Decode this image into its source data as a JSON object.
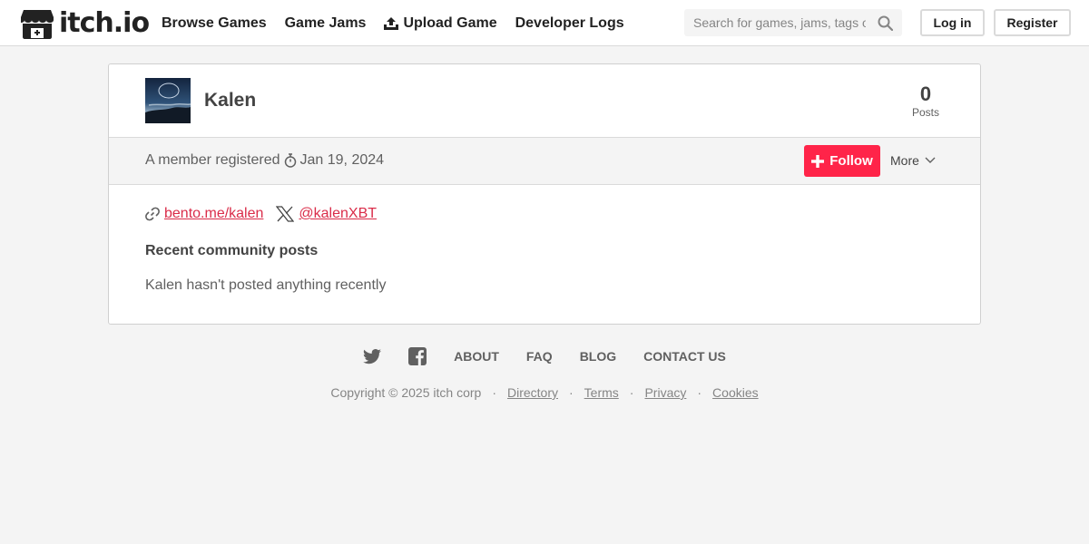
{
  "header": {
    "logo_text": "itch.io",
    "nav": [
      {
        "label": "Browse Games"
      },
      {
        "label": "Game Jams"
      },
      {
        "label": "Upload Game"
      },
      {
        "label": "Developer Logs"
      }
    ],
    "search_placeholder": "Search for games, jams, tags or creators",
    "login_label": "Log in",
    "register_label": "Register"
  },
  "profile": {
    "username": "Kalen",
    "posts_count": "0",
    "posts_label": "Posts",
    "member_text": "A member registered",
    "registered_date": "Jan 19, 2024",
    "follow_label": "Follow",
    "more_label": "More",
    "links": [
      {
        "text": "bento.me/kalen",
        "icon": "link-icon"
      },
      {
        "text": "@kalenXBT",
        "icon": "x-icon"
      }
    ],
    "recent_posts_title": "Recent community posts",
    "no_posts_text": "Kalen hasn't posted anything recently"
  },
  "footer": {
    "links": [
      "About",
      "FAQ",
      "Blog",
      "Contact us"
    ],
    "copyright": "Copyright © 2025 itch corp",
    "legal": [
      "Directory",
      "Terms",
      "Privacy",
      "Cookies"
    ]
  },
  "colors": {
    "accent": "#ff2449",
    "link": "#da2c49",
    "background": "#f4f4f4"
  }
}
